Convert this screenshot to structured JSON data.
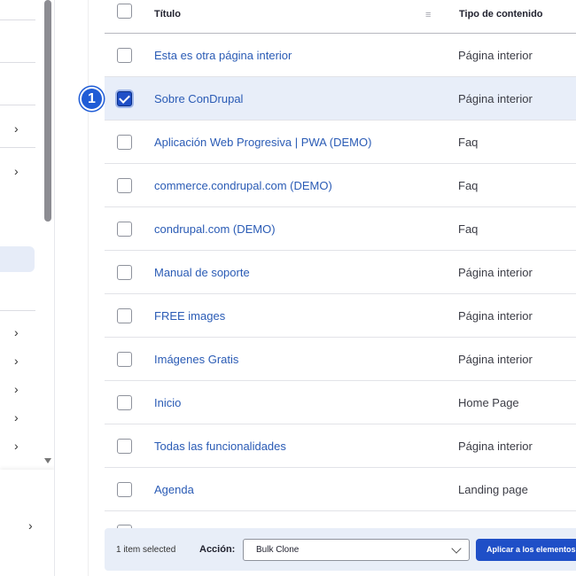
{
  "table": {
    "header": {
      "title": "Título",
      "content_type": "Tipo de contenido",
      "sort_icon": "sort-icon"
    },
    "rows": [
      {
        "title": "Esta es otra página interior",
        "type": "Página interior",
        "checked": false
      },
      {
        "title": "Sobre ConDrupal",
        "type": "Página interior",
        "checked": true
      },
      {
        "title": "Aplicación Web Progresiva | PWA (DEMO)",
        "type": "Faq",
        "checked": false
      },
      {
        "title": "commerce.condrupal.com (DEMO)",
        "type": "Faq",
        "checked": false
      },
      {
        "title": "condrupal.com (DEMO)",
        "type": "Faq",
        "checked": false
      },
      {
        "title": "Manual de soporte",
        "type": "Página interior",
        "checked": false
      },
      {
        "title": "FREE images",
        "type": "Página interior",
        "checked": false
      },
      {
        "title": "Imágenes Gratis",
        "type": "Página interior",
        "checked": false
      },
      {
        "title": "Inicio",
        "type": "Home Page",
        "checked": false
      },
      {
        "title": "Todas las funcionalidades",
        "type": "Página interior",
        "checked": false
      },
      {
        "title": "Agenda",
        "type": "Landing page",
        "checked": false
      }
    ]
  },
  "marker": {
    "label": "1"
  },
  "bulk": {
    "count": "1 item selected",
    "action_label": "Acción:",
    "select_value": "Bulk Clone",
    "apply_label": "Aplicar a los elementos seleccionados"
  },
  "sidebar": {
    "chevron": "›",
    "chevron_icon": "chevron-right-icon"
  },
  "colors": {
    "link": "#2a5bb5",
    "accent": "#1f4fc7",
    "selected_row": "#e8eef9",
    "bulk_bar": "#e8eef8"
  }
}
